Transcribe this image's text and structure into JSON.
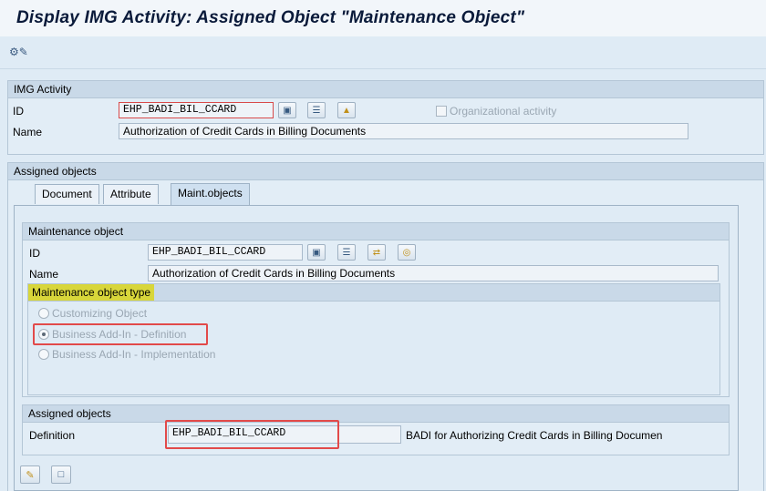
{
  "window": {
    "title": "Display IMG Activity: Assigned Object \"Maintenance Object\""
  },
  "img_activity": {
    "header": "IMG Activity",
    "id_label": "ID",
    "id_value": "EHP_BADI_BIL_CCARD",
    "name_label": "Name",
    "name_value": "Authorization of Credit Cards in Billing Documents",
    "org_activity_label": "Organizational activity"
  },
  "assigned_objects_header": "Assigned objects",
  "tabs": [
    {
      "label": "Document"
    },
    {
      "label": "Attribute"
    },
    {
      "label": "Maint.objects"
    }
  ],
  "maintenance_object": {
    "header": "Maintenance object",
    "id_label": "ID",
    "id_value": "EHP_BADI_BIL_CCARD",
    "name_label": "Name",
    "name_value": "Authorization of Credit Cards in Billing Documents",
    "type_header": "Maintenance object type",
    "options": [
      {
        "label": "Customizing Object"
      },
      {
        "label": "Business Add-In - Definition"
      },
      {
        "label": "Business Add-In - Implementation"
      }
    ]
  },
  "assigned_section": {
    "header": "Assigned objects",
    "definition_label": "Definition",
    "definition_value": "EHP_BADI_BIL_CCARD",
    "definition_desc": "BADI for Authorizing Credit Cards in Billing Documen"
  },
  "colors": {
    "highlight_red": "#e24a4a",
    "highlight_yellow": "#d8d63a",
    "group_header": "#c9d9e8"
  }
}
